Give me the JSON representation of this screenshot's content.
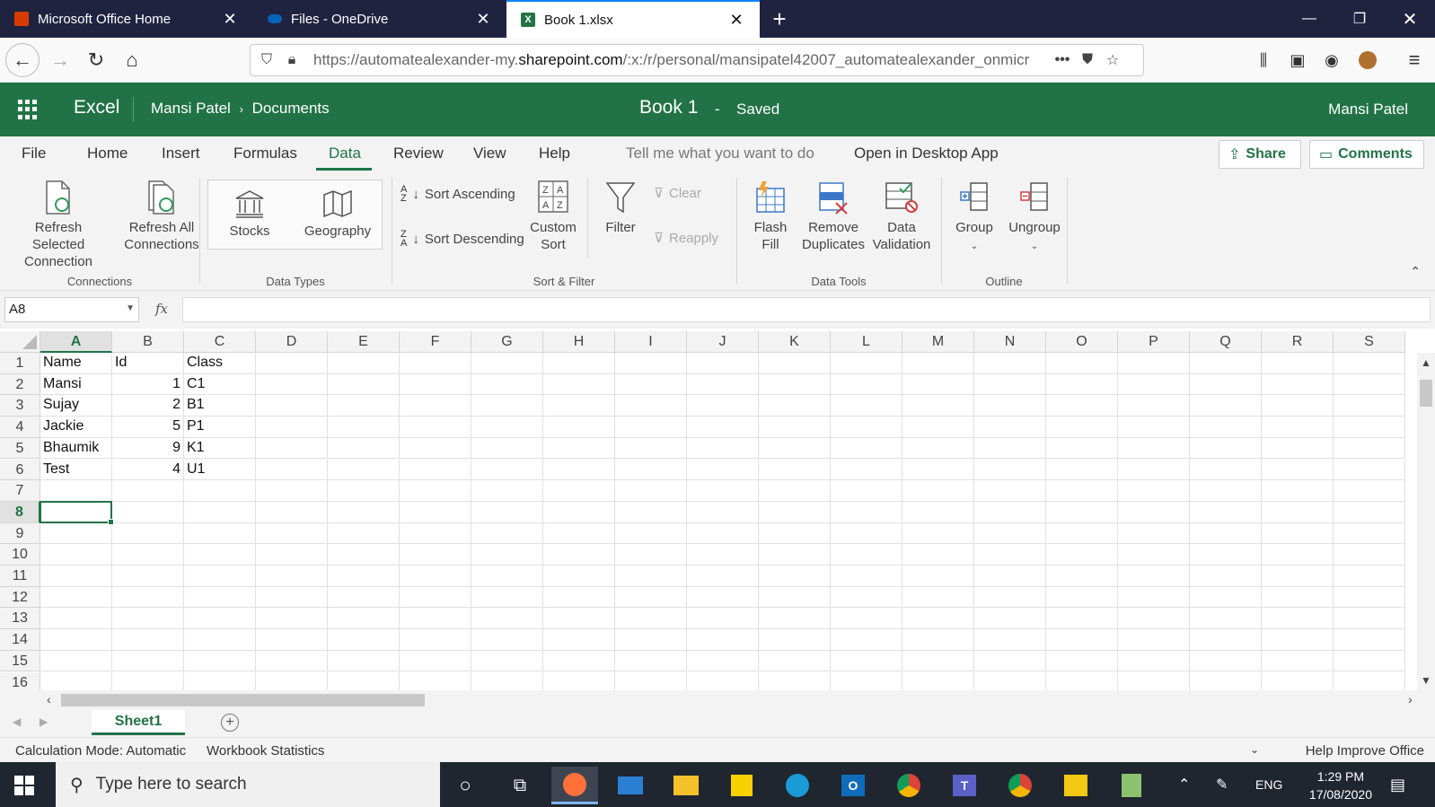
{
  "browser": {
    "tabs": [
      {
        "label": "Microsoft Office Home",
        "color": "#d83b01"
      },
      {
        "label": "Files - OneDrive",
        "color": "#0364b8"
      },
      {
        "label": "Book 1.xlsx",
        "color": "#217346"
      }
    ],
    "url_prefix": "https://automatealexander-my.",
    "url_domain": "sharepoint.com",
    "url_suffix": "/:x:/r/personal/mansipatel42007_automatealexander_onmicr"
  },
  "excel": {
    "app_name": "Excel",
    "breadcrumb_user": "Mansi Patel",
    "breadcrumb_folder": "Documents",
    "doc_title": "Book 1",
    "doc_sep": "-",
    "save_status": "Saved",
    "user_name": "Mansi Patel",
    "accent": "#217346"
  },
  "ribbon_tabs": [
    "File",
    "Home",
    "Insert",
    "Formulas",
    "Data",
    "Review",
    "View",
    "Help"
  ],
  "ribbon_extra": {
    "tell_me": "Tell me what you want to do",
    "open_desktop": "Open in Desktop App",
    "share": "Share",
    "comments": "Comments"
  },
  "ribbon": {
    "refresh_selected": [
      "Refresh Selected",
      "Connection"
    ],
    "refresh_all": [
      "Refresh All",
      "Connections"
    ],
    "stocks": "Stocks",
    "geography": "Geography",
    "sort_asc": "Sort Ascending",
    "sort_desc": "Sort Descending",
    "custom_sort": [
      "Custom",
      "Sort"
    ],
    "filter": "Filter",
    "clear": "Clear",
    "reapply": "Reapply",
    "flash_fill": [
      "Flash",
      "Fill"
    ],
    "remove_dup": [
      "Remove",
      "Duplicates"
    ],
    "data_validation": [
      "Data",
      "Validation"
    ],
    "group": "Group",
    "ungroup": "Ungroup",
    "groups": {
      "connections": "Connections",
      "data_types": "Data Types",
      "sort_filter": "Sort & Filter",
      "data_tools": "Data Tools",
      "outline": "Outline"
    }
  },
  "formula_bar": {
    "name_box": "A8",
    "fx": "fx",
    "value": ""
  },
  "grid": {
    "columns": [
      "A",
      "B",
      "C",
      "D",
      "E",
      "F",
      "G",
      "H",
      "I",
      "J",
      "K",
      "L",
      "M",
      "N",
      "O",
      "P",
      "Q",
      "R",
      "S"
    ],
    "rows": [
      "1",
      "2",
      "3",
      "4",
      "5",
      "6",
      "7",
      "8",
      "9",
      "10",
      "11",
      "12",
      "13",
      "14",
      "15",
      "16"
    ],
    "selected_col": "A",
    "selected_row": "8",
    "cells": [
      [
        "Name",
        "Id",
        "Class"
      ],
      [
        "Mansi",
        "1",
        "C1"
      ],
      [
        "Sujay",
        "2",
        "B1"
      ],
      [
        "Jackie",
        "5",
        "P1"
      ],
      [
        "Bhaumik",
        "9",
        "K1"
      ],
      [
        "Test",
        "4",
        "U1"
      ]
    ]
  },
  "sheets": [
    "Sheet1"
  ],
  "status": {
    "calc_mode": "Calculation Mode: Automatic",
    "workbook_stats": "Workbook Statistics",
    "help_improve": "Help Improve Office"
  },
  "taskbar": {
    "search_placeholder": "Type here to search",
    "language": "ENG",
    "time": "1:29 PM",
    "date": "17/08/2020"
  }
}
